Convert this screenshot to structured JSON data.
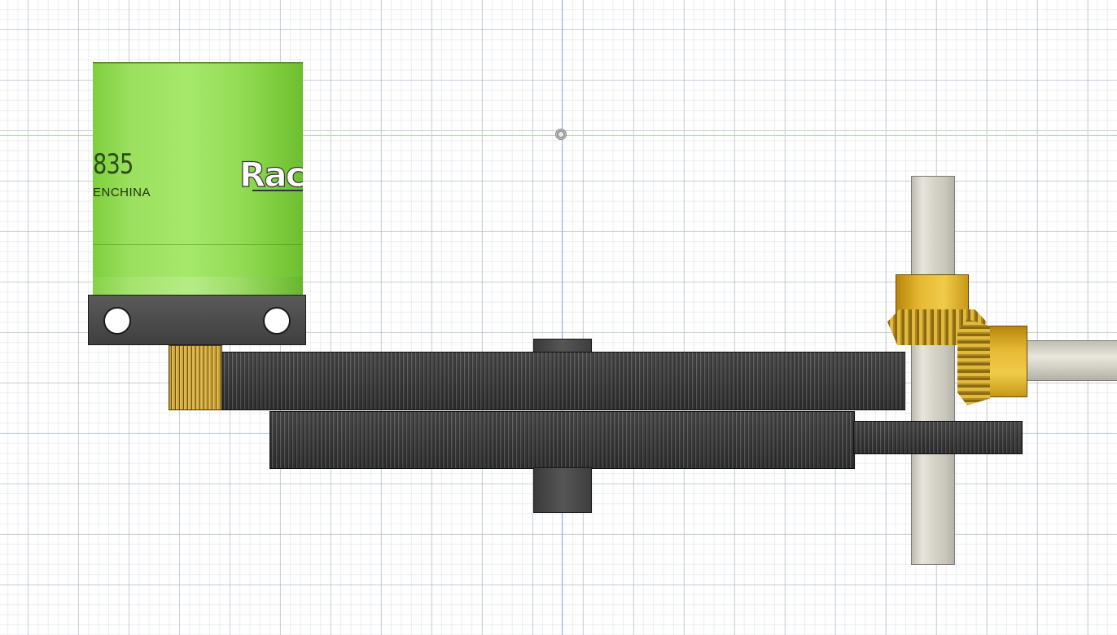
{
  "viewport": {
    "title": "",
    "axes": {
      "vertical_axis_color": "#9aa0ff",
      "horizontal_axis_color": "#a8e6a8"
    },
    "origin_icon": "origin-point-icon"
  },
  "motor": {
    "model_text": "835",
    "made_in_text": "ENCHINA",
    "logo_text": "Rac",
    "can_color": "#9be05e"
  },
  "mount_plate": {
    "color": "#4a4a4a"
  },
  "pinion": {
    "color": "#c9a23a"
  },
  "gears": {
    "spur_top": {
      "color": "#3a3a3a"
    },
    "spur_bottom": {
      "color": "#3a3a3a"
    },
    "output": {
      "color": "#3a3a3a"
    }
  },
  "shafts": {
    "vertical_color": "#d4d2c6",
    "horizontal_color": "#d4d2c6"
  },
  "bevel_gears": {
    "color": "#e2b940"
  }
}
